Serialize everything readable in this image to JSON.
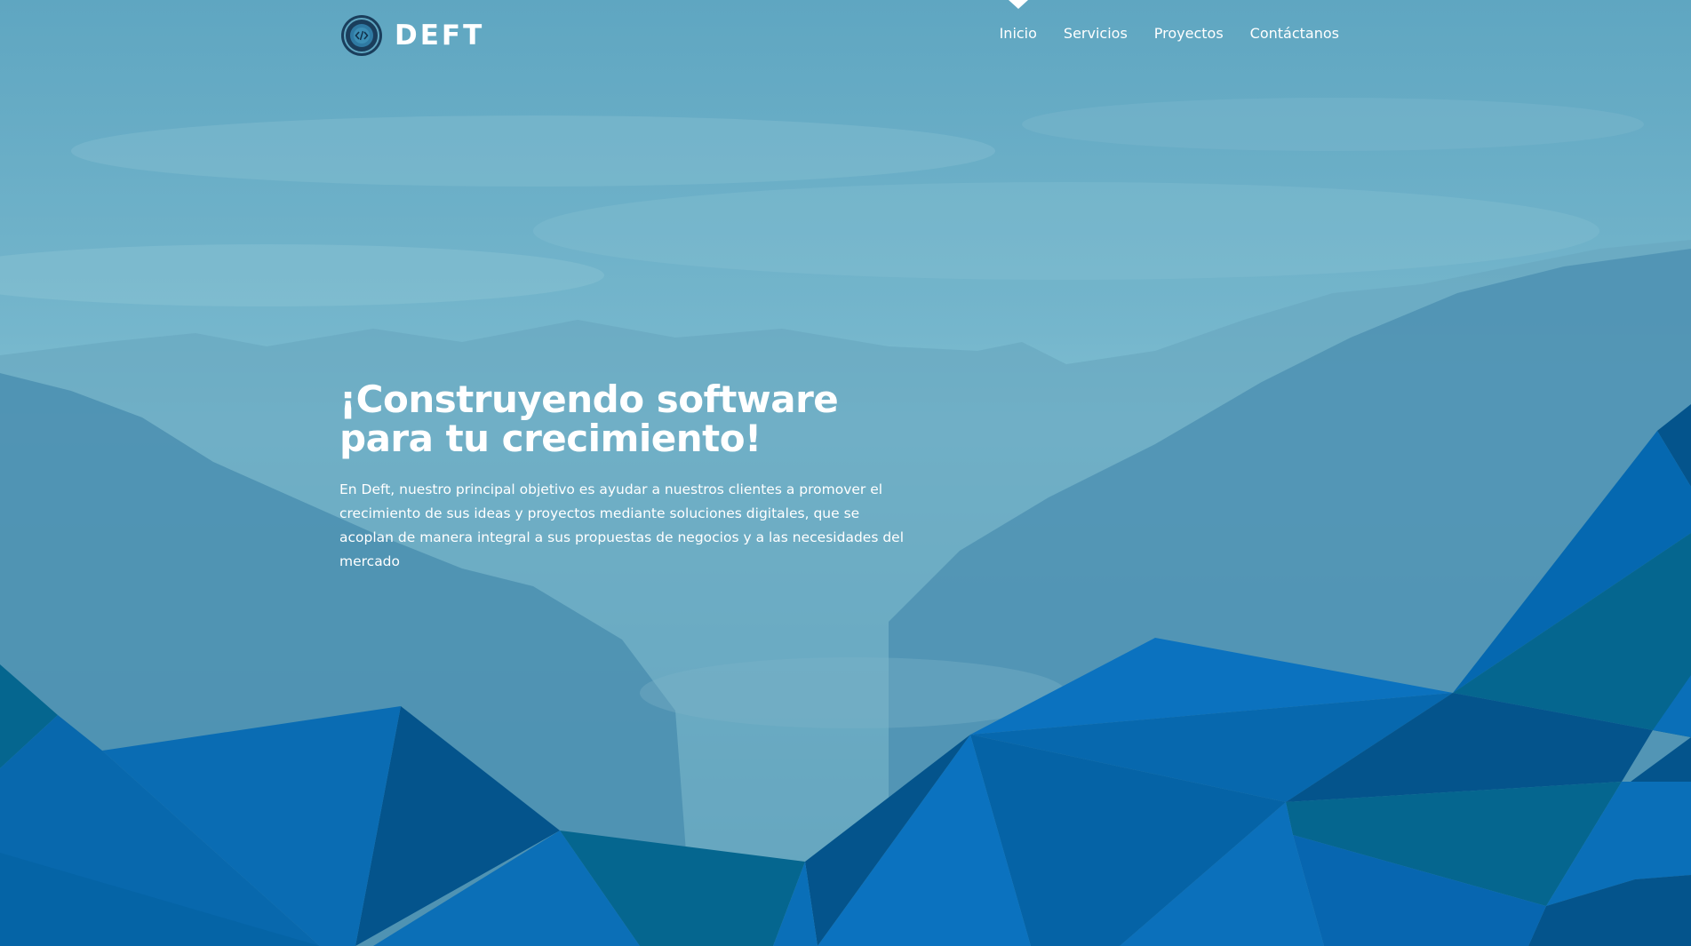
{
  "brand": {
    "name": "DEFT",
    "logo_icon": "code-brackets-circle-icon"
  },
  "nav": {
    "items": [
      {
        "label": "Inicio",
        "active": true
      },
      {
        "label": "Servicios",
        "active": false
      },
      {
        "label": "Proyectos",
        "active": false
      },
      {
        "label": "Contáctanos",
        "active": false
      }
    ]
  },
  "hero": {
    "headline": "¡Construyendo software para tu crecimiento!",
    "lead": "En Deft, nuestro principal objetivo es ayudar a nuestros clientes a promover el crecimiento de sus ideas y proyectos mediante soluciones digitales, que se acoplan de manera integral a sus propuestas de negocios y a las necesidades del mercado"
  },
  "colors": {
    "overlay_sky": "#66adc6",
    "mountains": "#3f88ab",
    "poly_blue": "#0a6fb8",
    "poly_dark": "#04548c",
    "poly_teal": "#05668f",
    "text": "#ffffff"
  }
}
